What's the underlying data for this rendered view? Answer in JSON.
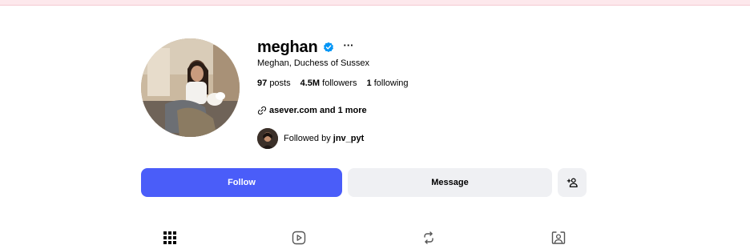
{
  "profile": {
    "username": "meghan",
    "full_name": "Meghan, Duchess of Sussex",
    "more_label": "···",
    "posts_count": "97",
    "posts_label": "posts",
    "followers_count": "4.5M",
    "followers_label": "followers",
    "following_count": "1",
    "following_label": "following",
    "link_text": "asever.com and 1 more",
    "followed_by_prefix": "Followed by",
    "followed_by_user": "jnv_pyt"
  },
  "actions": {
    "follow_label": "Follow",
    "message_label": "Message"
  },
  "colors": {
    "follow_button": "#4a5df9",
    "secondary_button": "#eff0f3",
    "verified_badge": "#0095f6",
    "top_strip": "#fde8ec"
  },
  "icons": {
    "verified": "verified-badge-icon",
    "more": "more-options-icon",
    "link": "link-icon",
    "add_person": "add-person-icon",
    "tab_posts": "grid-icon",
    "tab_reels": "reels-icon",
    "tab_reposts": "repost-icon",
    "tab_tagged": "tagged-person-icon"
  }
}
